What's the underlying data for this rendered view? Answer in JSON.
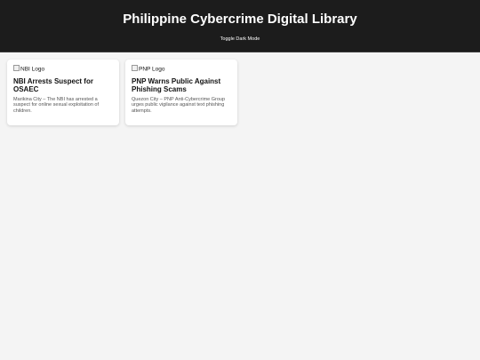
{
  "header": {
    "title": "Philippine Cybercrime Digital Library",
    "toggle_label": "Toggle Dark Mode"
  },
  "cards": [
    {
      "logo_alt": "NBI Logo",
      "title": "NBI Arrests Suspect for OSAEC",
      "text": "Marikina City – The NBI has arrested a suspect for online sexual exploitation of children."
    },
    {
      "logo_alt": "PNP Logo",
      "title": "PNP Warns Public Against Phishing Scams",
      "text": "Quezon City – PNP Anti-Cybercrime Group urges public vigilance against text phishing attempts."
    }
  ],
  "colors": {
    "header_bg": "#1c1c1c",
    "page_bg": "#f4f4f4",
    "card_bg": "#ffffff"
  }
}
